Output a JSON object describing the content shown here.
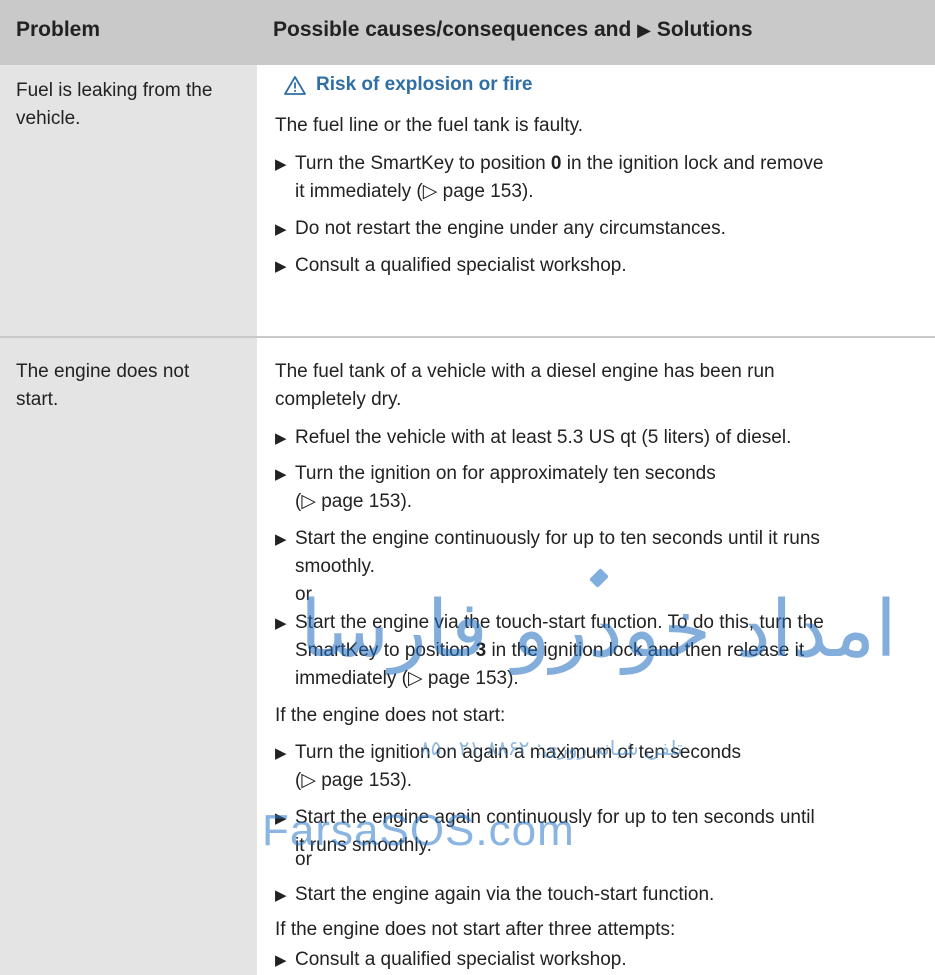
{
  "header": {
    "problem": "Problem",
    "solutions_prefix": "Possible causes/consequences and ",
    "solutions_arrow": "▶",
    "solutions_suffix": " Solutions"
  },
  "row1": {
    "problem_line1": "Fuel is leaking from the",
    "problem_line2": "vehicle.",
    "warning": "Risk of explosion or fire",
    "cause": "The fuel line or the fuel tank is faulty.",
    "step1_a": "Turn the SmartKey to position ",
    "step1_bold": "0",
    "step1_b": " in the ignition lock and remove",
    "step1_line2": "it immediately (▷ page 153).",
    "step2": "Do not restart the engine under any circumstances.",
    "step3": "Consult a qualified specialist workshop."
  },
  "row2": {
    "problem_line1": "The engine does not",
    "problem_line2": "start.",
    "cause_line1": "The fuel tank of a vehicle with a diesel engine has been run",
    "cause_line2": "completely dry.",
    "s1": "Refuel the vehicle with at least 5.3 US qt (5 liters) of diesel.",
    "s2_line1": "Turn the ignition on for approximately ten seconds",
    "s2_line2": "(▷ page 153).",
    "s3_line1": "Start the engine continuously for up to ten seconds until it runs",
    "s3_line2": "smoothly.",
    "or1": "or",
    "s4_line1": "Start the engine via the touch-start function. To do this, turn the",
    "s4_line2a": "SmartKey to position ",
    "s4_line2_bold": "3",
    "s4_line2b": " in the ignition lock and then release it",
    "s4_line3": "immediately (▷ page 153).",
    "if_not_start": "If the engine does not start:",
    "s5_line1": "Turn the ignition on again a maximum of ten seconds",
    "s5_line2": "(▷ page 153).",
    "s6_line1": "Start the engine again continuously for up to ten seconds until",
    "s6_line2": "it runs smoothly.",
    "or2": "or",
    "s7": "Start the engine again via the touch-start function.",
    "if_three": "If the engine does not start after three attempts:",
    "s8": "Consult a qualified specialist workshop."
  },
  "bullet": "▶",
  "watermark": {
    "farsi": "امداد خودرو فارسا",
    "phone": "تلفن شبانه روزی: ۸۸۶۲ ۰۲۱ ۸۵",
    "site": "FarsaSOS.com"
  },
  "colors": {
    "header_bg": "#c9c9c9",
    "left_column_bg": "#e4e4e4",
    "warning_blue": "#2f6fa6",
    "watermark_blue": "#2b78c9"
  }
}
